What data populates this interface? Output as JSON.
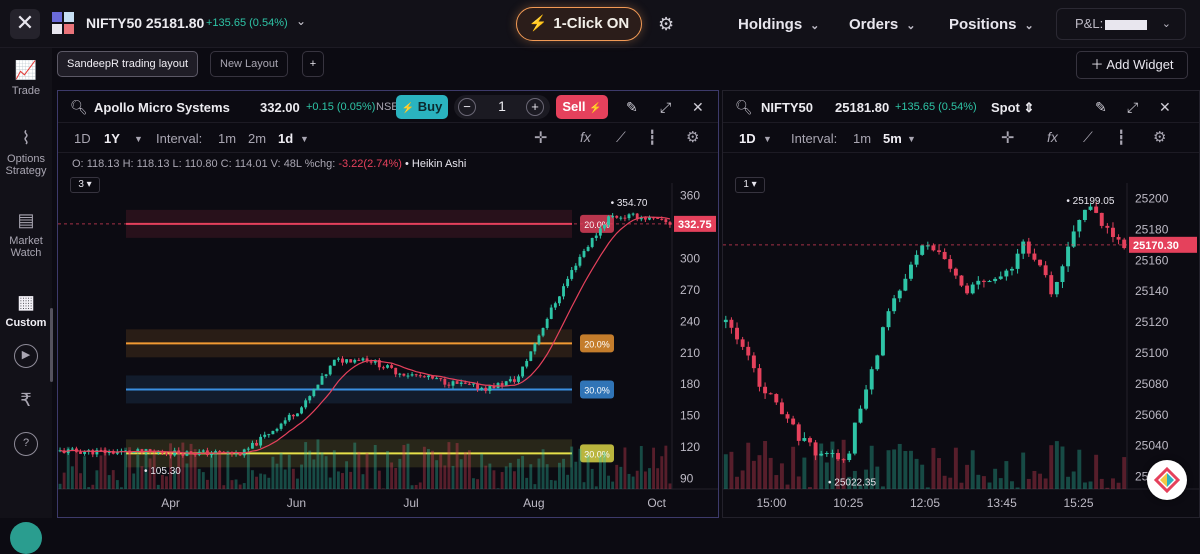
{
  "topbar": {
    "index_name": "NIFTY50 25181.80",
    "index_change": "+135.65 (0.54%)",
    "one_click": "1-Click ON",
    "nav": [
      "Holdings",
      "Orders",
      "Positions"
    ],
    "pnl_label": "P&L:"
  },
  "sidebar": {
    "items": [
      {
        "label": "Trade",
        "icon": "trend-line-icon"
      },
      {
        "label": "Options Strategy",
        "icon": "options-chart-icon"
      },
      {
        "label": "Market Watch",
        "icon": "watchlist-doc-icon"
      },
      {
        "label": "Custom",
        "icon": "layout-icon",
        "active": true
      }
    ],
    "play_icon": "▶",
    "rupee_icon": "₹",
    "help_icon": "?"
  },
  "layouts": {
    "current": "SandeepR trading layout",
    "new": "New Layout",
    "add": "+",
    "add_widget": "Add Widget"
  },
  "panel1": {
    "symbol": "Apollo Micro Systems",
    "price": "332.00",
    "change": "+0.15 (0.05%)",
    "exchange": "NSE",
    "buy": "Buy",
    "sell": "Sell",
    "qty": "1",
    "tf": [
      "1D",
      "1Y"
    ],
    "interval_label": "Interval:",
    "intervals": [
      "1m",
      "2m",
      "1d"
    ],
    "ohlc": {
      "o": "118.13",
      "h": "118.13",
      "l": "110.80",
      "c": "114.01",
      "v": "48L",
      "chg": "-3.22(2.74%)",
      "type": "Heikin Ashi"
    },
    "ohlc_labels": {
      "o": "O:",
      "h": "H:",
      "l": "L:",
      "c": "C:",
      "v": "V:",
      "chg": "%chg:"
    },
    "count": "3"
  },
  "panel2": {
    "symbol": "NIFTY50",
    "price": "25181.80",
    "change": "+135.65 (0.54%)",
    "segment": "Spot",
    "tf": "1D",
    "interval_label": "Interval:",
    "intervals": [
      "1m",
      "5m"
    ],
    "count": "1"
  },
  "chart_data": [
    {
      "type": "candlestick",
      "title": "Apollo Micro Systems",
      "x_ticks": [
        "Apr",
        "Jun",
        "Jul",
        "Aug",
        "Oct"
      ],
      "y_ticks": [
        90,
        120,
        150,
        180,
        210,
        240,
        270,
        300,
        330,
        360
      ],
      "ylim": [
        80,
        372
      ],
      "last_price": "332.75",
      "high_label": "354.70",
      "low_label": "105.30",
      "levels": [
        {
          "value": 333,
          "label": "20.0%",
          "color": "#e5415c"
        },
        {
          "value": 219,
          "label": "20.0%",
          "color": "#f29a33"
        },
        {
          "value": 175,
          "label": "30.0%",
          "color": "#3a8fe0"
        },
        {
          "value": 114,
          "label": "30.0%",
          "color": "#e6e04a"
        }
      ]
    },
    {
      "type": "candlestick",
      "title": "NIFTY50",
      "x_ticks": [
        "15:00",
        "10:25",
        "12:05",
        "13:45",
        "15:25"
      ],
      "y_ticks": [
        25020,
        25040,
        25060,
        25080,
        25100,
        25120,
        25140,
        25160,
        25180,
        25200
      ],
      "ylim": [
        25012,
        25210
      ],
      "last_price": "25170.30",
      "high_label": "25199.05",
      "low_label": "25022.35"
    }
  ]
}
